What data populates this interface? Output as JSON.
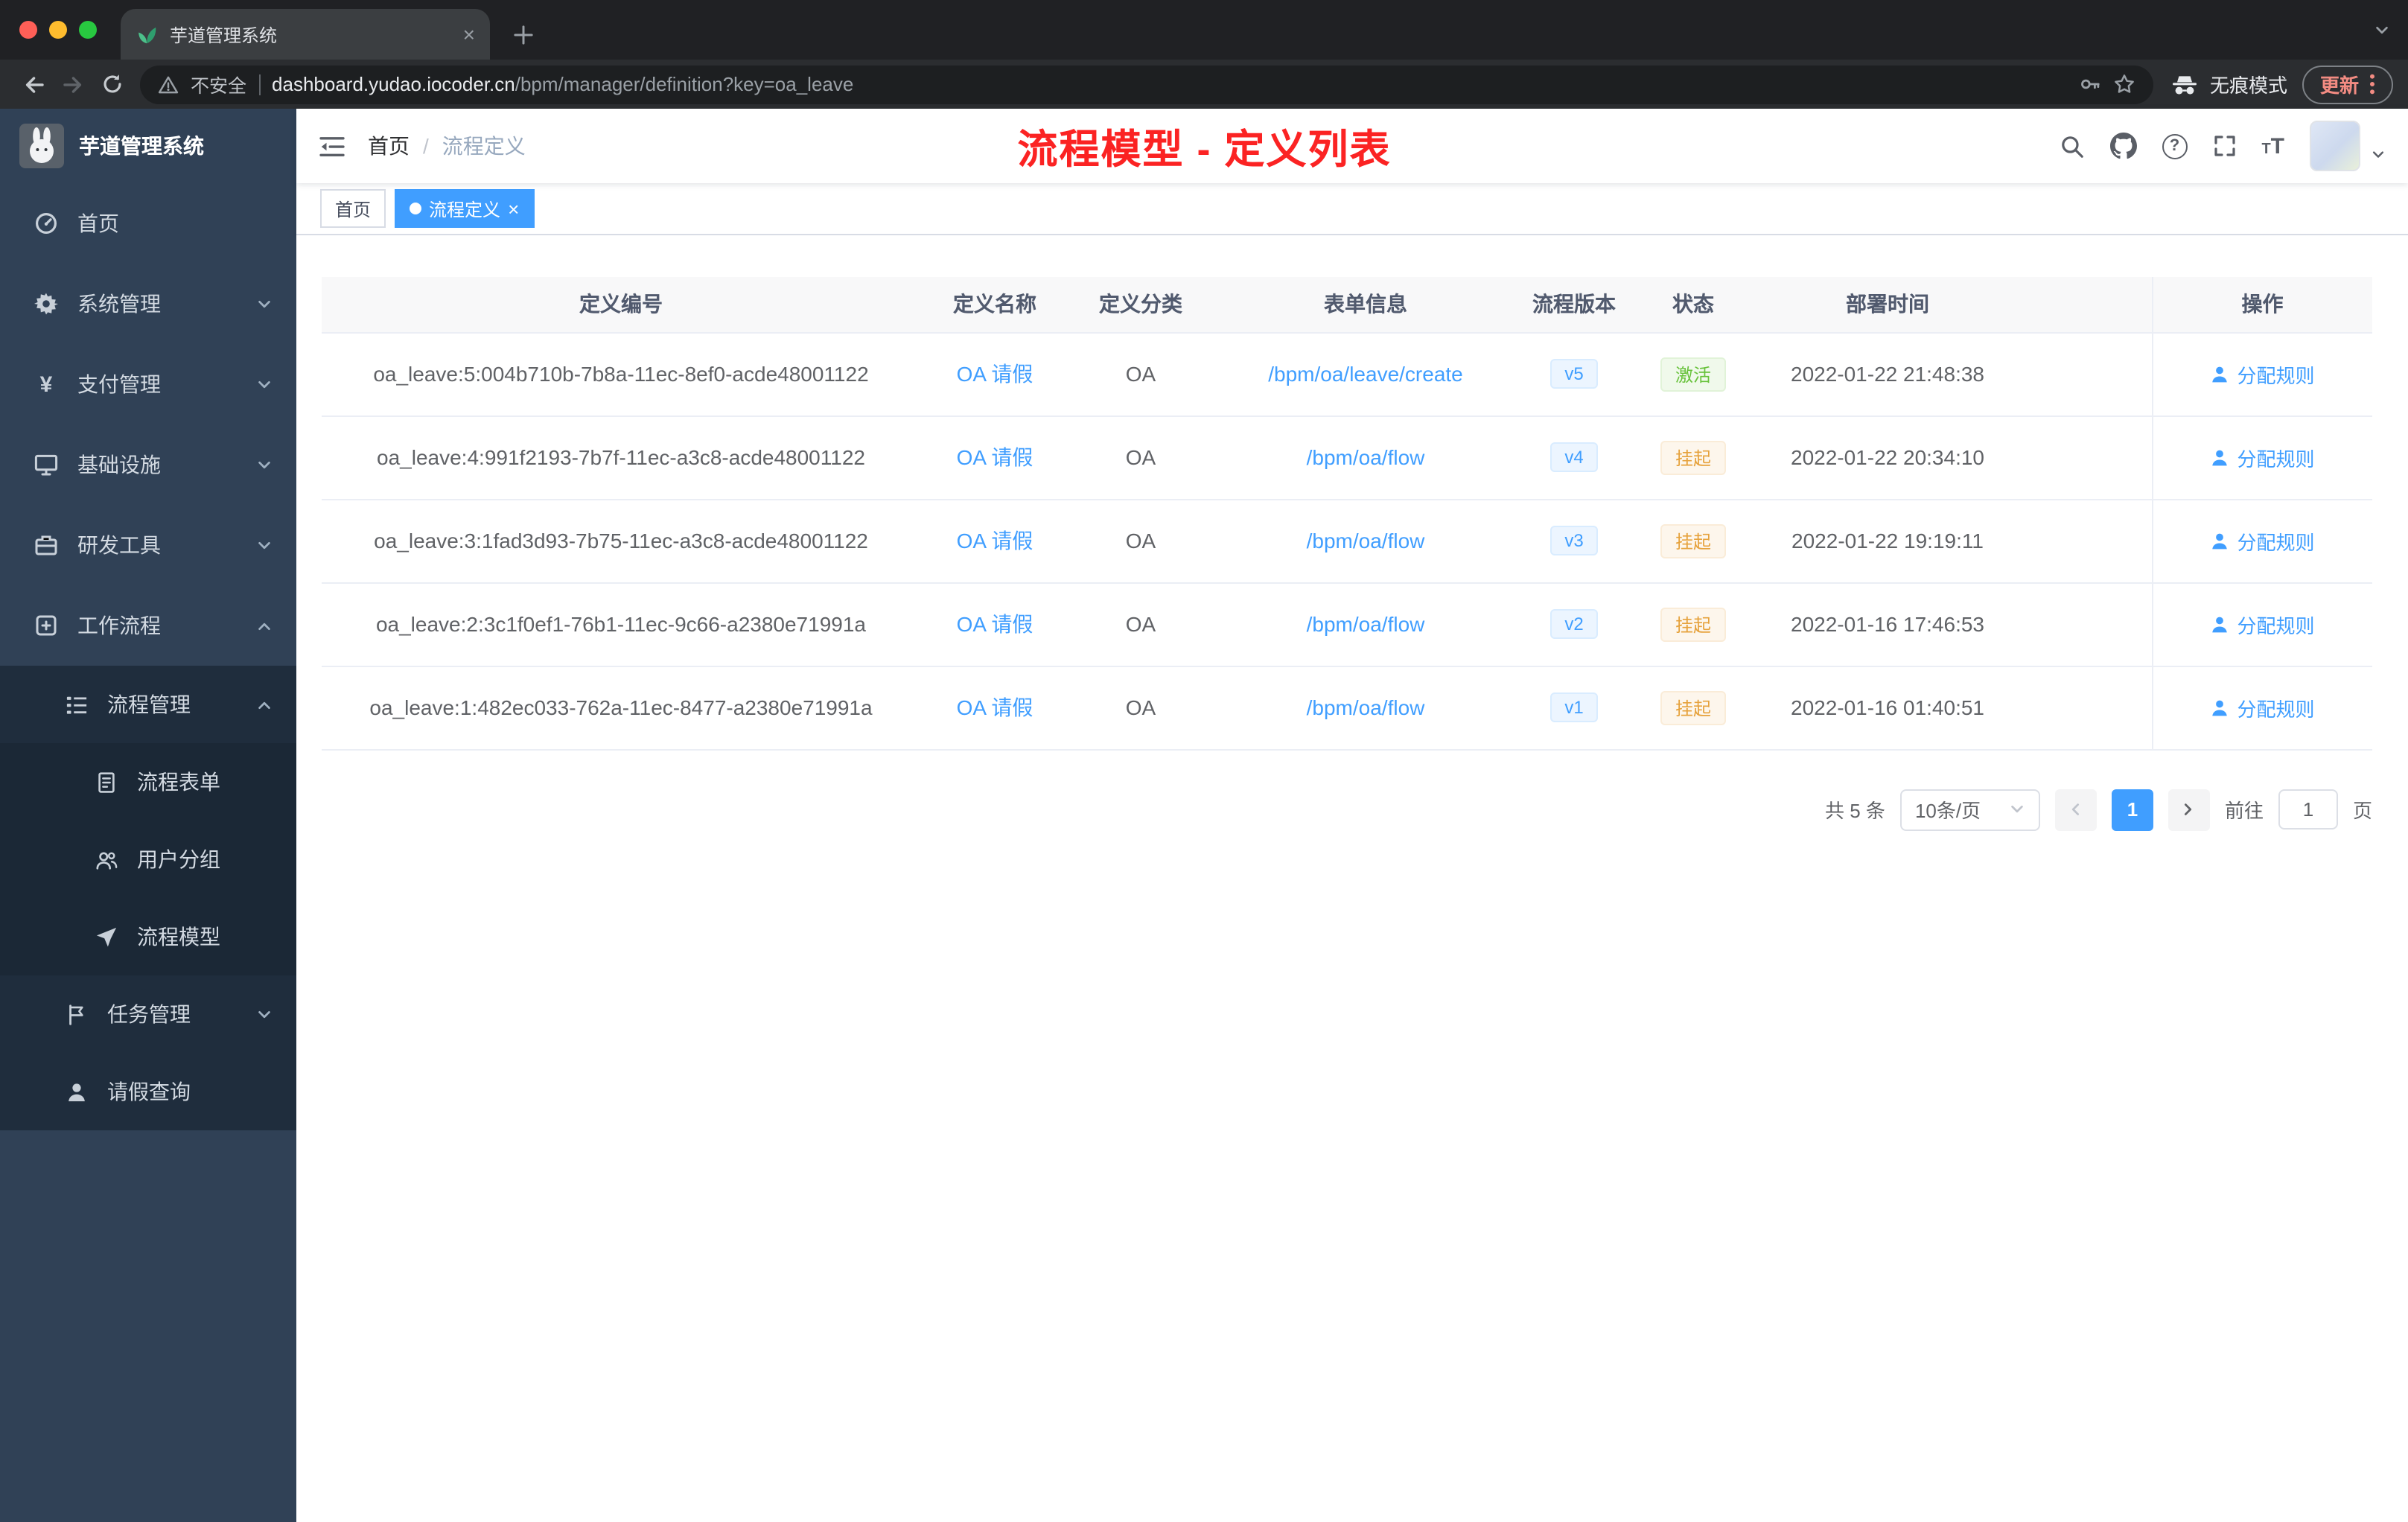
{
  "browser": {
    "tab": {
      "title": "芋道管理系统"
    },
    "address": {
      "security_label": "不安全",
      "host": "dashboard.yudao.iocoder.cn",
      "path": "/bpm/manager/definition?key=oa_leave"
    },
    "incognito_label": "无痕模式",
    "update_label": "更新"
  },
  "sidebar": {
    "app_title": "芋道管理系统",
    "menu": [
      {
        "label": "首页"
      },
      {
        "label": "系统管理"
      },
      {
        "label": "支付管理"
      },
      {
        "label": "基础设施"
      },
      {
        "label": "研发工具"
      },
      {
        "label": "工作流程"
      }
    ],
    "submenu": {
      "label": "流程管理",
      "children": [
        {
          "label": "流程表单"
        },
        {
          "label": "用户分组"
        },
        {
          "label": "流程模型"
        }
      ]
    },
    "menu_tail": [
      {
        "label": "任务管理"
      },
      {
        "label": "请假查询"
      }
    ]
  },
  "navbar": {
    "breadcrumb": {
      "home": "首页",
      "separator": "/",
      "current": "流程定义"
    },
    "annotation": "流程模型 - 定义列表"
  },
  "tags": {
    "items": [
      {
        "label": "首页"
      },
      {
        "label": "流程定义"
      }
    ]
  },
  "table": {
    "columns": [
      "定义编号",
      "定义名称",
      "定义分类",
      "表单信息",
      "流程版本",
      "状态",
      "部署时间",
      "操作"
    ],
    "rows": [
      {
        "id": "oa_leave:5:004b710b-7b8a-11ec-8ef0-acde48001122",
        "name": "OA 请假",
        "category": "OA",
        "form": "/bpm/oa/leave/create",
        "version": "v5",
        "status": "激活",
        "status_type": "success",
        "time": "2022-01-22 21:48:38",
        "action": "分配规则"
      },
      {
        "id": "oa_leave:4:991f2193-7b7f-11ec-a3c8-acde48001122",
        "name": "OA 请假",
        "category": "OA",
        "form": "/bpm/oa/flow",
        "version": "v4",
        "status": "挂起",
        "status_type": "warning",
        "time": "2022-01-22 20:34:10",
        "action": "分配规则"
      },
      {
        "id": "oa_leave:3:1fad3d93-7b75-11ec-a3c8-acde48001122",
        "name": "OA 请假",
        "category": "OA",
        "form": "/bpm/oa/flow",
        "version": "v3",
        "status": "挂起",
        "status_type": "warning",
        "time": "2022-01-22 19:19:11",
        "action": "分配规则"
      },
      {
        "id": "oa_leave:2:3c1f0ef1-76b1-11ec-9c66-a2380e71991a",
        "name": "OA 请假",
        "category": "OA",
        "form": "/bpm/oa/flow",
        "version": "v2",
        "status": "挂起",
        "status_type": "warning",
        "time": "2022-01-16 17:46:53",
        "action": "分配规则"
      },
      {
        "id": "oa_leave:1:482ec033-762a-11ec-8477-a2380e71991a",
        "name": "OA 请假",
        "category": "OA",
        "form": "/bpm/oa/flow",
        "version": "v1",
        "status": "挂起",
        "status_type": "warning",
        "time": "2022-01-16 01:40:51",
        "action": "分配规则"
      }
    ]
  },
  "pagination": {
    "total": "共 5 条",
    "page_size": "10条/页",
    "page": "1",
    "goto_label": "前往",
    "goto_value": "1",
    "goto_unit": "页"
  },
  "colors": {
    "accent": "#409eff",
    "sidebar_bg": "#304156",
    "submenu_bg": "#1f2d3d",
    "success": "#67c23a",
    "warning": "#e6a23c",
    "annotation_red": "#fb2323"
  }
}
